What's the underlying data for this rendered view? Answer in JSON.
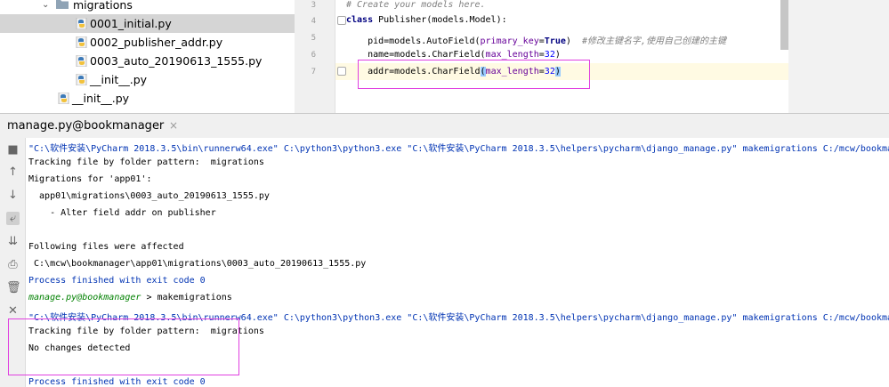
{
  "project_tree": {
    "items": [
      {
        "label": "migrations",
        "type": "folder"
      },
      {
        "label": "0001_initial.py",
        "type": "file",
        "selected": true
      },
      {
        "label": "0002_publisher_addr.py",
        "type": "file"
      },
      {
        "label": "0003_auto_20190613_1555.py",
        "type": "file"
      },
      {
        "label": "__init__.py",
        "type": "file"
      },
      {
        "label": "__init__.py",
        "type": "file"
      }
    ]
  },
  "editor": {
    "line_numbers": [
      "3",
      "4",
      "5",
      "6",
      "7"
    ],
    "lines": {
      "l3": "# Create your models here.",
      "l4_kw": "class",
      "l4_rest": " Publisher(models.Model):",
      "l5_a": "    pid=models.AutoField(",
      "l5_prm": "primary_key",
      "l5_eq": "=",
      "l5_true": "True",
      "l5_b": ")  ",
      "l5_cm": "#修改主键名字,使用自己创建的主键",
      "l6_a": "    name=models.CharField(",
      "l6_prm": "max_length",
      "l6_eq": "=",
      "l6_num": "32",
      "l6_b": ")",
      "l7_a": "    addr=models.CharField",
      "l7_p1": "(",
      "l7_prm": "max_length",
      "l7_eq": "=",
      "l7_num": "32",
      "l7_p2": ")"
    }
  },
  "run_panel": {
    "tab_label": "manage.py@bookmanager",
    "close_glyph": "×",
    "toolbar_icons": [
      "stop-icon",
      "arrow-up-icon",
      "arrow-down-icon",
      "soft-wrap-icon",
      "scroll-to-end-icon",
      "print-icon",
      "trash-icon",
      "close-icon"
    ]
  },
  "console": {
    "lines": [
      "\"C:\\软件安装\\PyCharm 2018.3.5\\bin\\runnerw64.exe\" C:\\python3\\python3.exe \"C:\\软件安装\\PyCharm 2018.3.5\\helpers\\pycharm\\django_manage.py\" makemigrations C:/mcw/bookmanager",
      "Tracking file by folder pattern:  migrations",
      "Migrations for 'app01':",
      "  app01\\migrations\\0003_auto_20190613_1555.py",
      "    - Alter field addr on publisher",
      "",
      "Following files were affected",
      " C:\\mcw\\bookmanager\\app01\\migrations\\0003_auto_20190613_1555.py",
      "Process finished with exit code 0",
      "",
      "\"C:\\软件安装\\PyCharm 2018.3.5\\bin\\runnerw64.exe\" C:\\python3\\python3.exe \"C:\\软件安装\\PyCharm 2018.3.5\\helpers\\pycharm\\django_manage.py\" makemigrations C:/mcw/bookmanager",
      "Tracking file by folder pattern:  migrations",
      "No changes detected",
      "",
      "Process finished with exit code 0"
    ],
    "prompt_name": "manage.py@bookmanager",
    "prompt_arrow": " > ",
    "prompt_cmd": "makemigrations"
  },
  "colors": {
    "highlight_box": "#e040e0",
    "selection": "#d5d5d5",
    "caret_line": "#fffae3"
  }
}
